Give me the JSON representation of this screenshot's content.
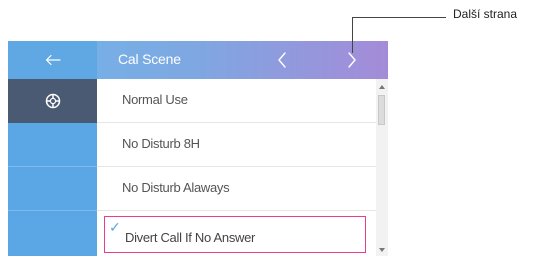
{
  "header": {
    "title": "Cal Scene",
    "back_icon": "arrow-left-icon",
    "prev_icon": "chevron-left-icon",
    "next_icon": "chevron-right-icon"
  },
  "sidebar": {
    "items": [
      {
        "icon": "lifebuoy-icon",
        "active": true
      },
      {
        "icon": "",
        "active": false
      },
      {
        "icon": "",
        "active": false
      },
      {
        "icon": "",
        "active": false
      }
    ]
  },
  "list": {
    "items": [
      {
        "label": "Normal Use",
        "selected": false
      },
      {
        "label": "No Disturb 8H",
        "selected": false
      },
      {
        "label": "No Disturb Alaways",
        "selected": false
      },
      {
        "label": "Divert Call If No Answer",
        "selected": true
      }
    ]
  },
  "callout": {
    "label": "Další strana"
  },
  "colors": {
    "header_start": "#6fb6e9",
    "header_end": "#a48bd8",
    "sidebar": "#5ba7e6",
    "sidebar_active": "#4b5a73",
    "highlight_border": "#e83e8c"
  }
}
